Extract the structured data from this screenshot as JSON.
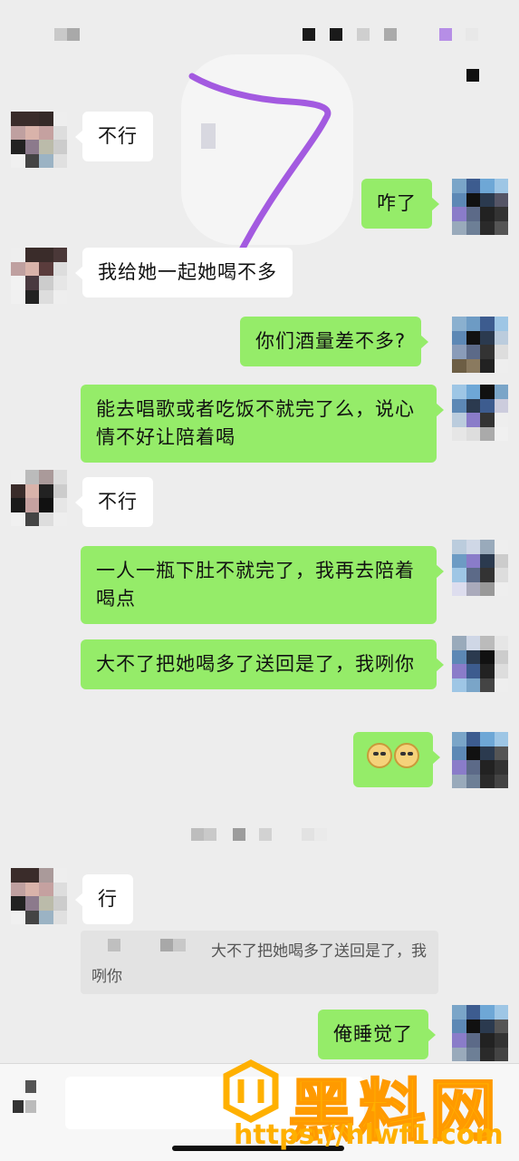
{
  "messages": {
    "m1": "不行",
    "m2": "咋了",
    "m3": "我给她一起她喝不多",
    "m4": "你们酒量差不多?",
    "m5": "能去唱歌或者吃饭不就完了么，说心情不好让陪着喝",
    "m6": "不行",
    "m7": "一人一瓶下肚不就完了，我再去陪着喝点",
    "m8": "大不了把她喝多了送回是了，我咧你",
    "m10": "行",
    "m11": "俺睡觉了"
  },
  "quote": {
    "text": "大不了把她喝多了送回是了，我咧你"
  },
  "watermark": {
    "brand": "黑料网",
    "url": "https://hlwf1.com"
  },
  "colors": {
    "background": "#ededed",
    "incoming_bubble": "#ffffff",
    "outgoing_bubble": "#95ec69",
    "annotation": "#a35ae0",
    "watermark": "#ffb000"
  }
}
